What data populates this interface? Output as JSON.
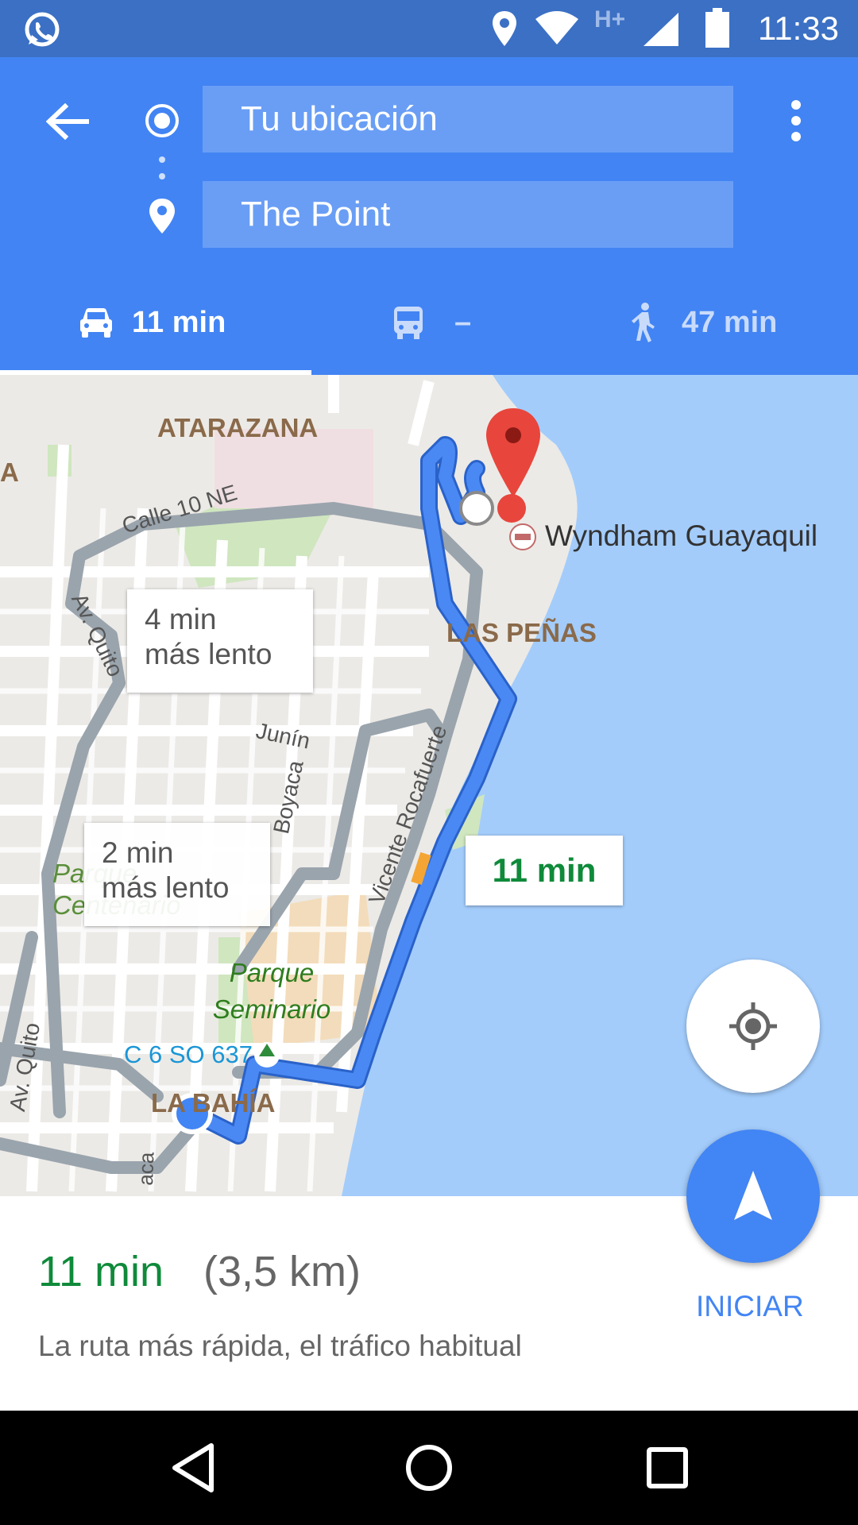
{
  "status_bar": {
    "time": "11:33",
    "network": "H+",
    "icons": [
      "whatsapp-icon",
      "location-icon",
      "wifi-icon",
      "signal-icon",
      "battery-icon"
    ]
  },
  "directions": {
    "origin": "Tu ubicación",
    "destination": "The Point"
  },
  "modes": {
    "car": "11 min",
    "transit": "–",
    "walk": "47 min"
  },
  "map": {
    "labels": {
      "atarazana": "ATARAZANA",
      "a_partial": "A",
      "las_penas": "LAS PEÑAS",
      "wyndham": "Wyndham Guayaquil",
      "calle": "Calle 10 NE",
      "av_quito_top": "Av. Quito",
      "av_quito_bottom": "Av. Quito",
      "boyaca": "Boyaca",
      "junin": "Junín",
      "vicente": "Vicente Rocafuerte",
      "parque_centenario": "Parque Centenario",
      "parque_seminario": "Parque Seminario",
      "address": "C 6 SO 637",
      "la_bahia": "LA BAHÍA",
      "bottom_street": "aca"
    },
    "callouts": {
      "alt1_line1": "4 min",
      "alt1_line2": "más lento",
      "alt2_line1": "2 min",
      "alt2_line2": "más lento",
      "main": "11 min"
    }
  },
  "summary": {
    "duration": "11 min",
    "distance": "(3,5 km)",
    "description": "La ruta más rápida, el tráfico habitual",
    "start_label": "INICIAR"
  },
  "colors": {
    "primary": "#4284f3",
    "status_bar": "#3b70c4",
    "route": "#4a89f3",
    "green": "#0f8a3a",
    "water": "#a3ccfb"
  }
}
